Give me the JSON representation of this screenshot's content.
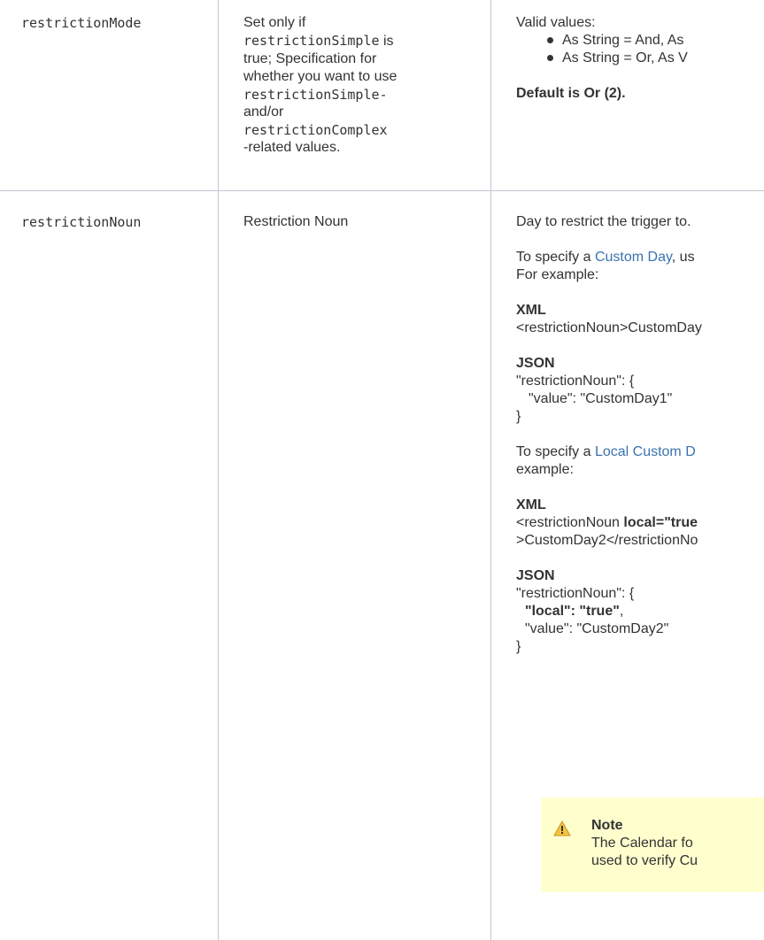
{
  "rows": [
    {
      "param": "restrictionMode",
      "desc": {
        "t1": "Set only if",
        "c1": "restrictionSimple",
        "t2": "is",
        "t3": "true; Specification for",
        "t4": "whether you want to use",
        "c2": "restrictionSimple-",
        "t5": "and/or",
        "c3": "restrictionComplex",
        "t6": "-related values."
      },
      "valid_values_label": "Valid values:",
      "valid_values": [
        "As String = And, As",
        "As String = Or, As V"
      ],
      "default": "Default is Or (2)."
    },
    {
      "param": "restrictionNoun",
      "desc": "Restriction Noun",
      "intro": "Day to restrict the trigger to.",
      "custom_day_pre": "To specify a ",
      "custom_day_link": "Custom Day",
      "custom_day_post": ", us",
      "for_example": "For example:",
      "xml_label_1": "XML",
      "xml_code_1": "<restrictionNoun>CustomDay",
      "json_label_1": "JSON",
      "json_1_line1": "\"restrictionNoun\": {",
      "json_1_line2": "\"value\": \"CustomDay1\"",
      "json_1_line3": "}",
      "local_pre": "To specify a ",
      "local_link": "Local Custom D",
      "local_example": "example:",
      "xml_label_2": "XML",
      "xml_2_line1_pre": "<restrictionNoun ",
      "xml_2_line1_bold": "local=\"true",
      "xml_2_line2": ">CustomDay2</restrictionNo",
      "json_label_2": "JSON",
      "json_2_line1": "\"restrictionNoun\": {",
      "json_2_line2_bold": "\"local\": \"true\"",
      "json_2_line2_post": ",",
      "json_2_line3": "\"value\": \"CustomDay2\"",
      "json_2_line4": "}"
    }
  ],
  "note": {
    "title": "Note",
    "line1": "The Calendar fo",
    "line2": "used to verify Cu",
    "icon": "warning-icon",
    "background": "#ffffce"
  },
  "colors": {
    "link": "#3b73af",
    "border": "#c1c7d0",
    "text": "#333333"
  }
}
